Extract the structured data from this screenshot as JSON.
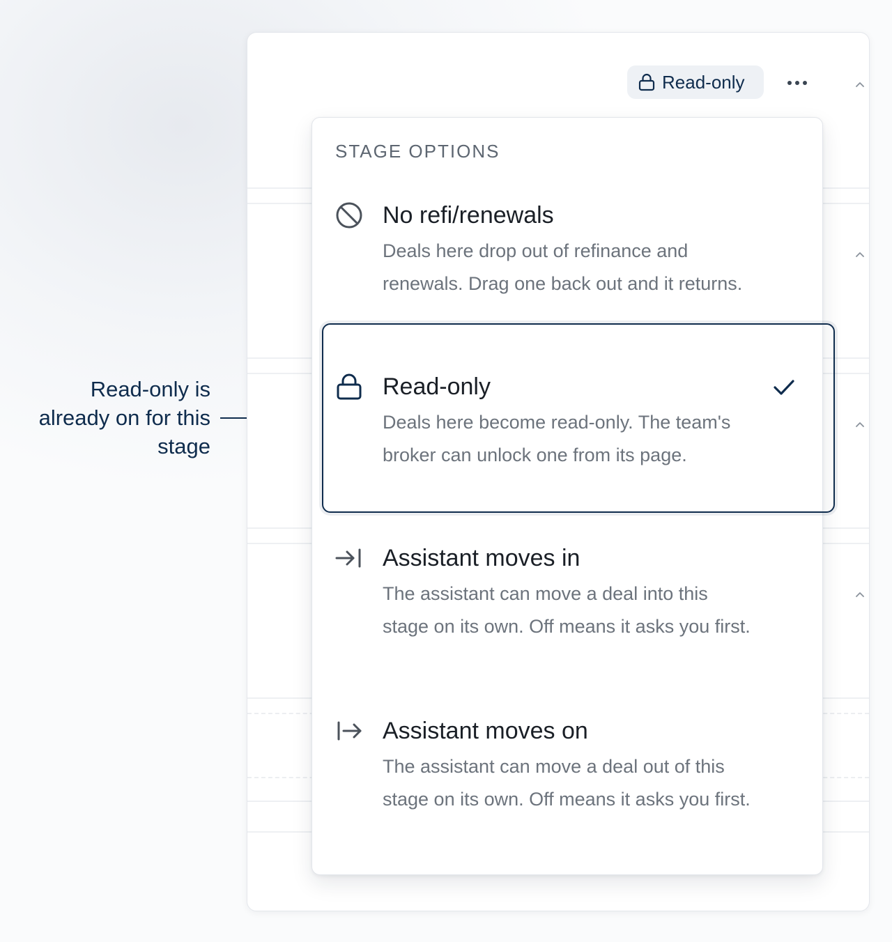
{
  "header": {
    "read_only_pill_label": "Read-only",
    "more_icon": "more-horizontal-icon"
  },
  "menu": {
    "heading": "STAGE OPTIONS",
    "selected_option": "Read-only",
    "options": [
      {
        "icon": "ban-icon",
        "title": "No refi/renewals",
        "description": "Deals here drop out of refinance and renewals. Drag one back out and it returns."
      },
      {
        "icon": "lock-icon",
        "title": "Read-only",
        "description": "Deals here become read-only. The team's broker can unlock one from its page.",
        "checked": true
      },
      {
        "icon": "arrow-right-to-line-icon",
        "title": "Assistant moves in",
        "description": "The assistant can move a deal into this stage on its own. Off means it asks you first."
      },
      {
        "icon": "arrow-right-from-line-icon",
        "title": "Assistant moves on",
        "description": "The assistant can move a deal out of this stage on its own. Off means it asks you first."
      }
    ]
  },
  "annotation": {
    "text": "Read-only is already on for this stage"
  },
  "colors": {
    "accent_navy": "#0f2c4d",
    "muted_text": "#6c737c",
    "title_text": "#1a1f26"
  }
}
